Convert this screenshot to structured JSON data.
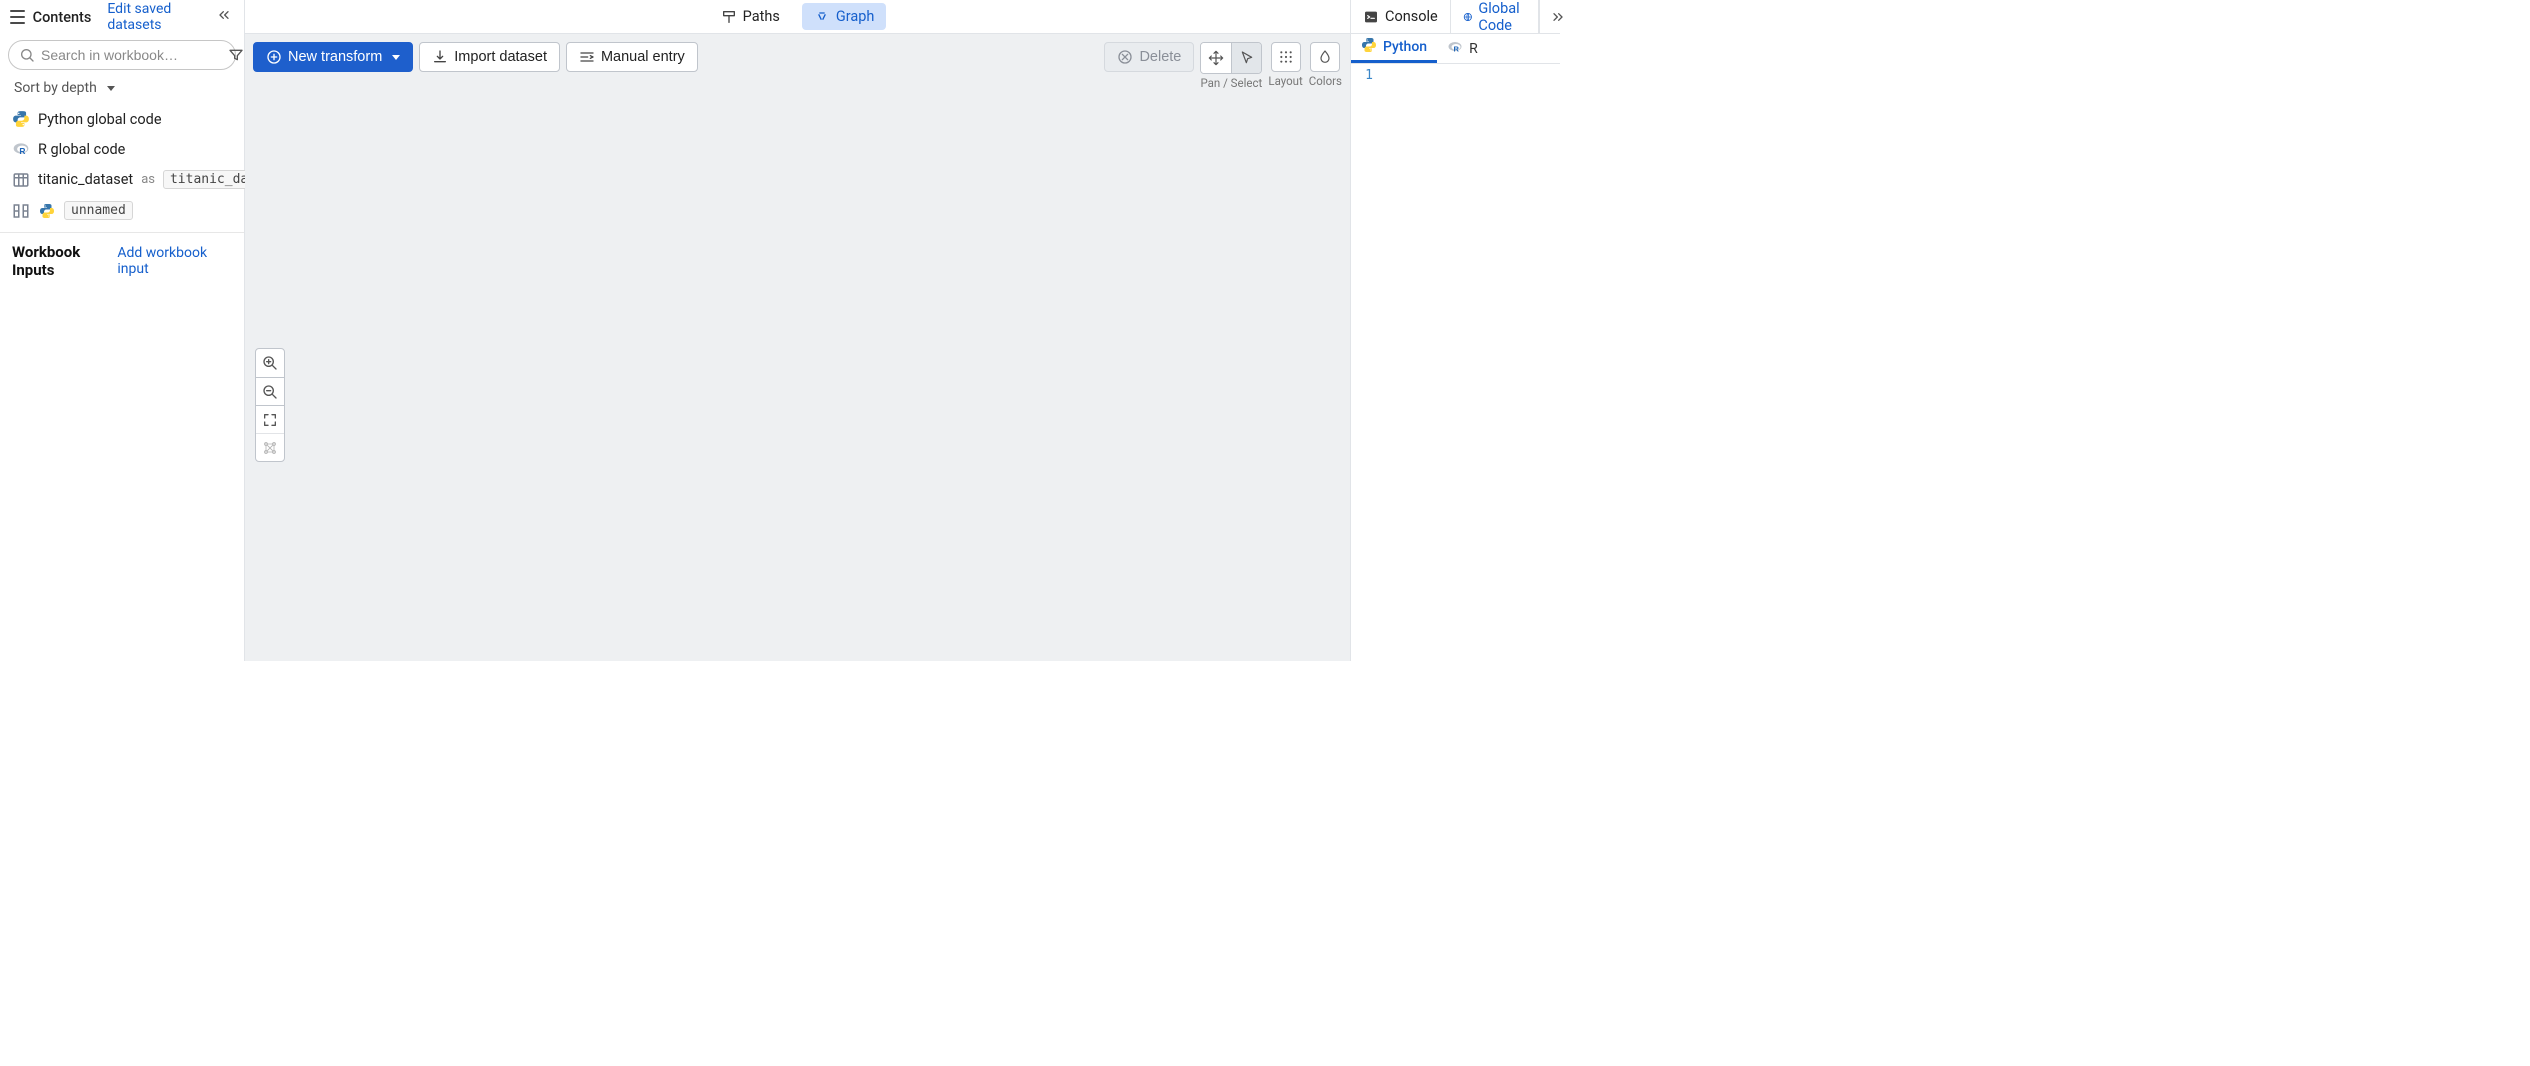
{
  "sidebar": {
    "title": "Contents",
    "edit_link": "Edit saved datasets",
    "search_placeholder": "Search in workbook…",
    "sort_label": "Sort by depth",
    "items": [
      {
        "icon": "python",
        "label": "Python global code"
      },
      {
        "icon": "r",
        "label": "R global code"
      },
      {
        "icon": "table",
        "label": "titanic_dataset",
        "as": "as",
        "alias": "titanic_dataset"
      },
      {
        "icon": "transform-python",
        "chip": "unnamed"
      }
    ],
    "inputs_heading": "Workbook Inputs",
    "add_input_link": "Add workbook input"
  },
  "center": {
    "tabs": {
      "paths": "Paths",
      "graph": "Graph",
      "active": "graph"
    },
    "toolbar": {
      "new_transform": "New transform",
      "import_dataset": "Import dataset",
      "manual_entry": "Manual entry",
      "delete": "Delete",
      "captions": {
        "panselect": "Pan / Select",
        "layout": "Layout",
        "colors": "Colors"
      }
    }
  },
  "right": {
    "tabs": {
      "console": "Console",
      "global_code": "Global Code",
      "active": "global_code"
    },
    "lang_tabs": {
      "python": "Python",
      "r": "R",
      "active": "python"
    },
    "editor": {
      "line_number": "1"
    }
  }
}
